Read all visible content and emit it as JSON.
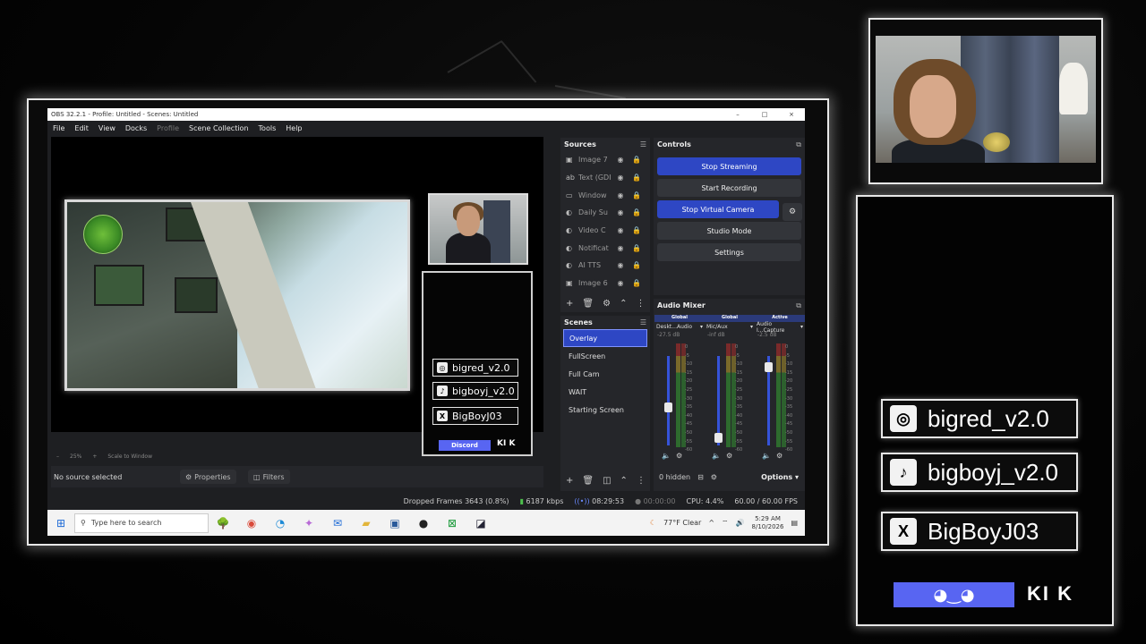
{
  "window": {
    "title": "OBS 32.2.1 - Profile: Untitled - Scenes: Untitled",
    "controls": [
      "–",
      "□",
      "×"
    ]
  },
  "menu": [
    "File",
    "Edit",
    "View",
    "Docks",
    "Profile",
    "Scene Collection",
    "Tools",
    "Help"
  ],
  "preview": {
    "zoom": "25%",
    "scale_mode": "Scale to Window",
    "socials": [
      {
        "icon": "instagram-icon",
        "glyph": "◎",
        "handle": "bigred_v2.0"
      },
      {
        "icon": "tiktok-icon",
        "glyph": "♪",
        "handle": "bigboyj_v2.0"
      },
      {
        "icon": "x-icon",
        "glyph": "X",
        "handle": "BigBoyJ03"
      }
    ],
    "discord_label": "Discord",
    "kick_label": "KI K"
  },
  "source_bar": {
    "no_source": "No source selected",
    "properties": "Properties",
    "filters": "Filters"
  },
  "sources": {
    "title": "Sources",
    "items": [
      {
        "icon": "▣",
        "label": "Image 7"
      },
      {
        "icon": "ab",
        "label": "Text (GDI+)"
      },
      {
        "icon": "▭",
        "label": "Window"
      },
      {
        "icon": "◐",
        "label": "Daily Su"
      },
      {
        "icon": "◐",
        "label": "Video C"
      },
      {
        "icon": "◐",
        "label": "Notificat"
      },
      {
        "icon": "◐",
        "label": "AI TTS"
      },
      {
        "icon": "▣",
        "label": "Image 6"
      }
    ]
  },
  "scenes": {
    "title": "Scenes",
    "items": [
      "Overlay",
      "FullScreen",
      "Full Cam",
      "WAIT",
      "Starting Screen"
    ],
    "active": "Overlay"
  },
  "controls": {
    "title": "Controls",
    "stop_streaming": "Stop Streaming",
    "start_recording": "Start Recording",
    "stop_virtual_camera": "Stop Virtual Camera",
    "studio_mode": "Studio Mode",
    "settings": "Settings"
  },
  "audio_mixer": {
    "title": "Audio Mixer",
    "channels": [
      {
        "tag": "Global",
        "name": "Deskt...Audio",
        "db": "-27.5 dB",
        "level": 0.42
      },
      {
        "tag": "Global",
        "name": "Mic/Aux",
        "db": "-inf dB",
        "level": 0.05
      },
      {
        "tag": "Active",
        "name": "Audio I...Capture",
        "db": "-2.5 dB",
        "level": 0.92
      }
    ],
    "ticks": [
      "0",
      "-5",
      "-10",
      "-15",
      "-20",
      "-25",
      "-30",
      "-35",
      "-40",
      "-45",
      "-50",
      "-55",
      "-60"
    ],
    "hidden": "0 hidden",
    "options": "Options"
  },
  "status": {
    "dropped_frames": "Dropped Frames 3643 (0.8%)",
    "bitrate": "6187 kbps",
    "stream_time": "08:29:53",
    "rec_time": "00:00:00",
    "cpu": "CPU: 4.4%",
    "fps": "60.00 / 60.00 FPS"
  },
  "taskbar": {
    "search_placeholder": "Type here to search",
    "weather": "77°F  Clear",
    "time": "5:29 AM",
    "date": "8/10/2026"
  },
  "overlay_right": {
    "socials": [
      {
        "icon": "instagram-icon",
        "glyph": "◎",
        "handle": "bigred_v2.0"
      },
      {
        "icon": "tiktok-icon",
        "glyph": "♪",
        "handle": "bigboyj_v2.0"
      },
      {
        "icon": "x-icon",
        "glyph": "X",
        "handle": "BigBoyJ03"
      }
    ],
    "kick_label": "KI K"
  }
}
